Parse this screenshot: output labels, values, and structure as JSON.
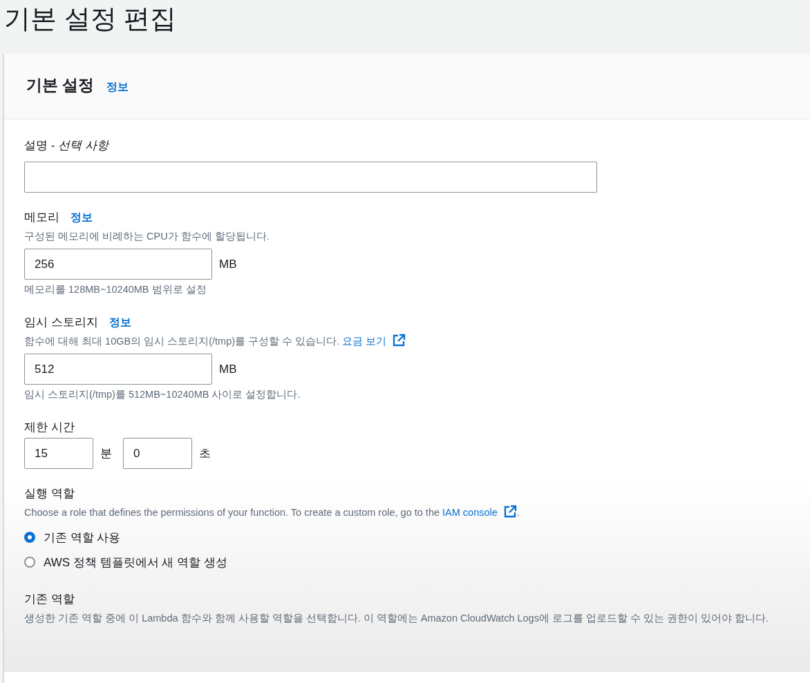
{
  "page_title": "기본 설정 편집",
  "panel": {
    "title": "기본 설정",
    "info_link": "정보"
  },
  "fields": [
    {
      "kind": "text",
      "label": "설명 - *선택 사항*"
    },
    {
      "kind": "number",
      "label": "메모리",
      "info": "정보",
      "description": "구성된 메모리에 비례하는 CPU가 함수에 할당됩니다.",
      "value": "256",
      "unit": "MB",
      "constraint": "메모리를 128MB~10240MB 범위로 설정"
    },
    {
      "kind": "number",
      "label": "임시 스토리지",
      "info": "정보",
      "description": "함수에 대해 최대 10GB의 임시 스토리지(/tmp)를 구성할 수 있습니다. ",
      "link": "요금 보기",
      "value": "512",
      "unit": "MB",
      "constraint": "임시 스토리지(/tmp)를 512MB~10240MB 사이로 설정합니다."
    },
    {
      "kind": "timeout",
      "label": "제한 시간",
      "minutes": "15",
      "minutes_unit": "분",
      "seconds": "0",
      "seconds_unit": "초"
    },
    {
      "kind": "radio",
      "label": "실행 역할",
      "description": "Choose a role that defines the permissions of your function. To create a custom role, go to the ",
      "link": "IAM console",
      "description_end": ".",
      "options": [
        {
          "label": "기존 역할 사용",
          "selected": true
        },
        {
          "label": "AWS 정책 템플릿에서 새 역할 생성",
          "selected": false
        }
      ]
    },
    {
      "kind": "heading",
      "label": "기존 역할",
      "description": "생성한 기존 역할 중에 이 Lambda 함수와 함께 사용할 역할을 선택합니다. 이 역할에는 Amazon CloudWatch Logs에 로그를 업로드할 수 있는 권한이 있어야 합니다."
    }
  ]
}
